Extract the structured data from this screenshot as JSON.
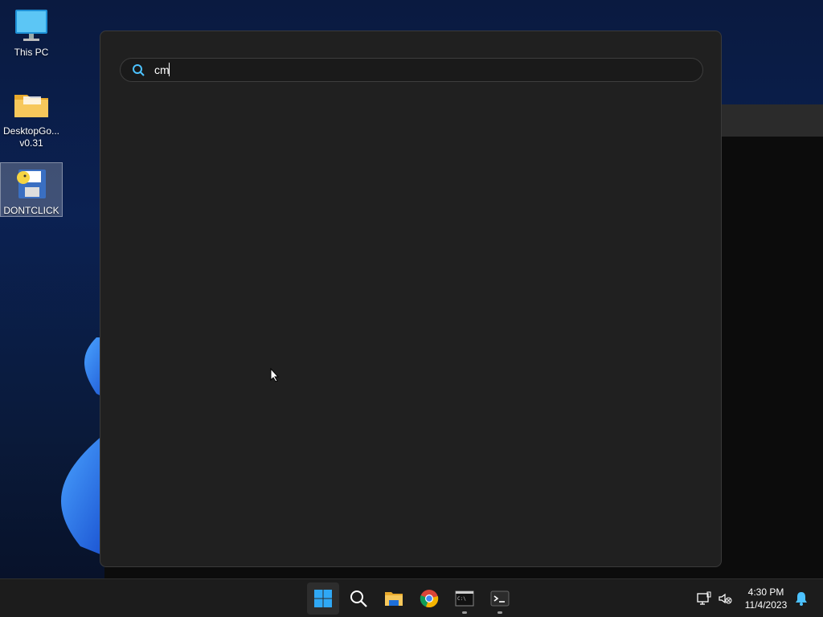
{
  "desktop": {
    "icons": [
      {
        "label": "This PC"
      },
      {
        "label": "DesktopGo...\nv0.31"
      },
      {
        "label": "DONTCLICK"
      }
    ]
  },
  "search": {
    "value": "cm",
    "placeholder": ""
  },
  "taskbar": {
    "apps": [
      {
        "name": "start",
        "icon": "windows-logo-icon"
      },
      {
        "name": "search",
        "icon": "search-icon"
      },
      {
        "name": "file-explorer",
        "icon": "folder-icon"
      },
      {
        "name": "chrome",
        "icon": "chrome-icon"
      },
      {
        "name": "command-prompt",
        "icon": "cmd-icon"
      },
      {
        "name": "terminal",
        "icon": "terminal-icon"
      }
    ],
    "clock": {
      "time": "4:30 PM",
      "date": "11/4/2023"
    }
  },
  "colors": {
    "accent": "#0078d4",
    "flyout_bg": "#202020",
    "taskbar_bg": "#1c1c1c"
  }
}
